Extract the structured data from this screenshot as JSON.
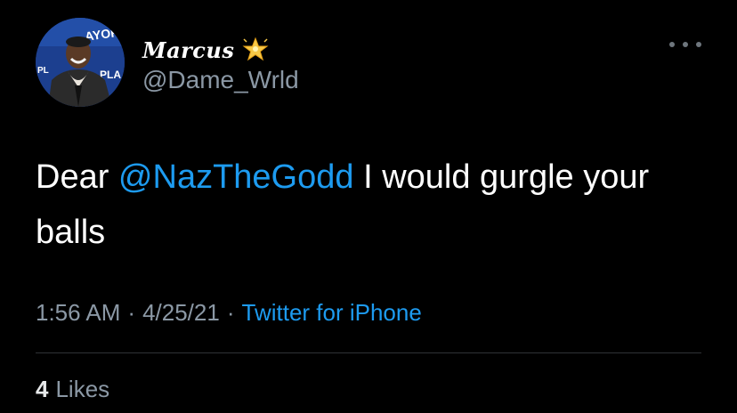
{
  "author": {
    "display_name": "Marcus",
    "badge_icon": "glowing-star-icon",
    "handle": "@Dame_Wrld",
    "avatar_icon": "user-avatar"
  },
  "menu_icon": "more-options-icon",
  "tweet": {
    "text_before": "Dear ",
    "mention": "@NazTheGodd",
    "text_after": " I would gurgle your balls"
  },
  "meta": {
    "time": "1:56 AM",
    "separator1": "·",
    "date": "4/25/21",
    "separator2": "·",
    "source": "Twitter for iPhone"
  },
  "engagement": {
    "likes_count": "4",
    "likes_label": "Likes"
  },
  "colors": {
    "background": "#000000",
    "text": "#ffffff",
    "secondary": "#8b98a5",
    "accent": "#1d9bf0"
  }
}
